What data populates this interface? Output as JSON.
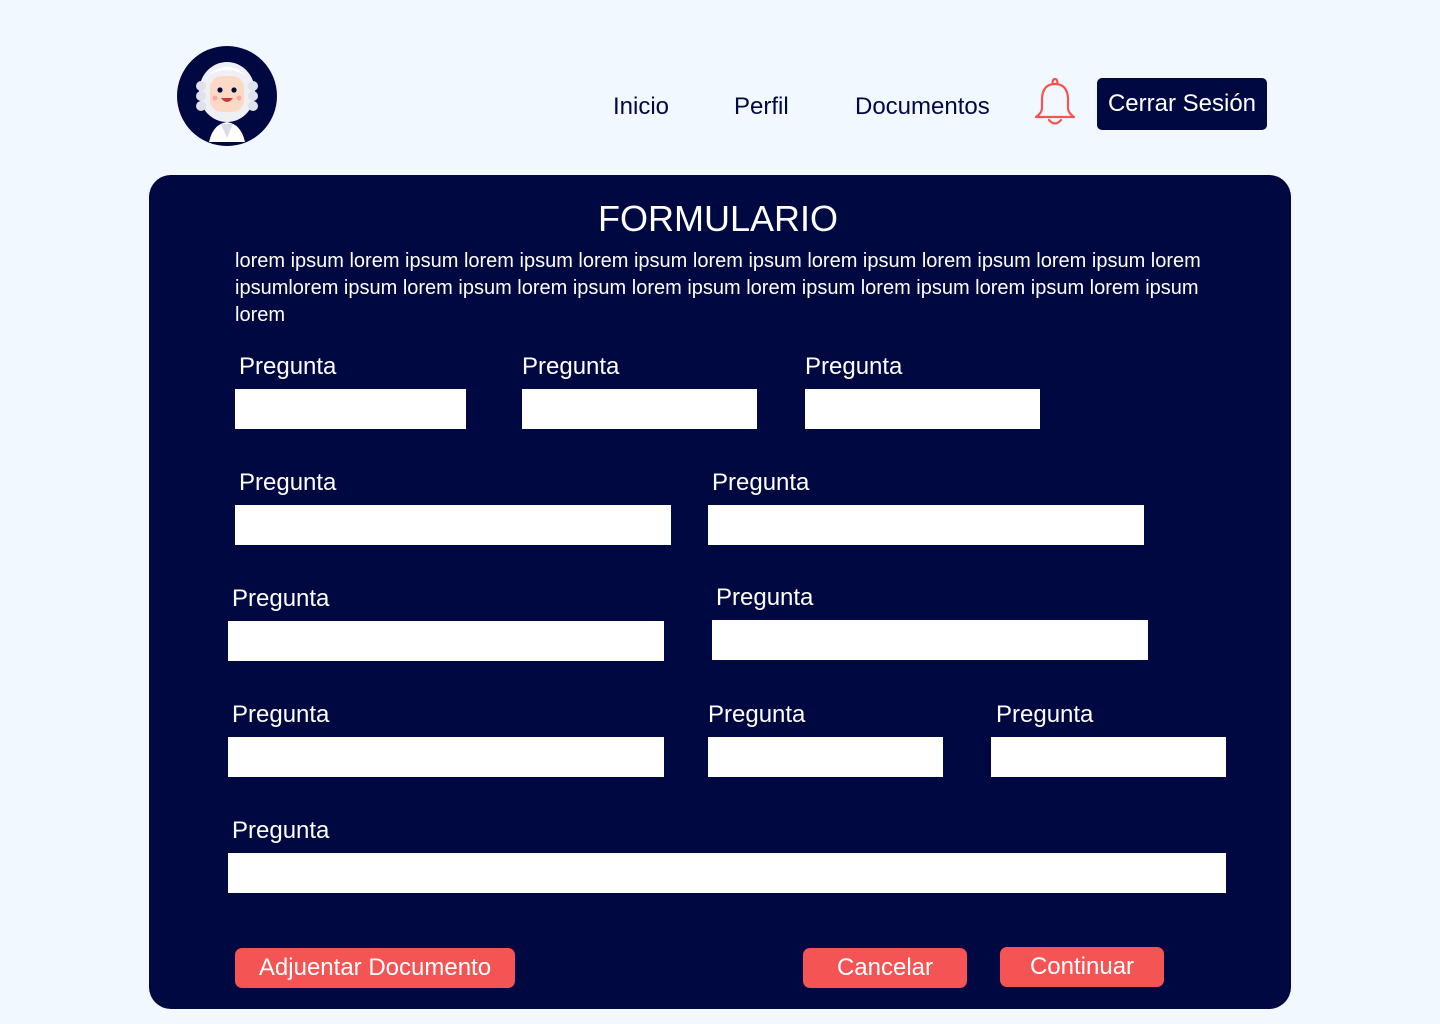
{
  "header": {
    "nav": {
      "home": "Inicio",
      "profile": "Perfil",
      "documents": "Documentos"
    },
    "logout_label": "Cerrar Sesión"
  },
  "form": {
    "title": "FORMULARIO",
    "description": "lorem ipsum lorem ipsum lorem ipsum lorem ipsum lorem ipsum lorem ipsum lorem ipsum lorem ipsum lorem ipsumlorem ipsum lorem ipsum lorem ipsum lorem ipsum lorem ipsum lorem ipsum lorem ipsum lorem ipsum lorem",
    "questions": [
      {
        "label": "Pregunta",
        "value": ""
      },
      {
        "label": "Pregunta",
        "value": ""
      },
      {
        "label": "Pregunta",
        "value": ""
      },
      {
        "label": "Pregunta",
        "value": ""
      },
      {
        "label": "Pregunta",
        "value": ""
      },
      {
        "label": "Pregunta",
        "value": ""
      },
      {
        "label": "Pregunta",
        "value": ""
      },
      {
        "label": "Pregunta",
        "value": ""
      },
      {
        "label": "Pregunta",
        "value": ""
      },
      {
        "label": "Pregunta",
        "value": ""
      },
      {
        "label": "Pregunta",
        "value": ""
      }
    ],
    "attach_label": "Adjuentar Documento",
    "cancel_label": "Cancelar",
    "continue_label": "Continuar"
  },
  "icons": {
    "avatar": "judge-avatar-icon",
    "notifications": "bell-icon"
  },
  "colors": {
    "background": "#f1f8ff",
    "primary": "#000842",
    "accent": "#f45454",
    "field": "#ffffff"
  }
}
